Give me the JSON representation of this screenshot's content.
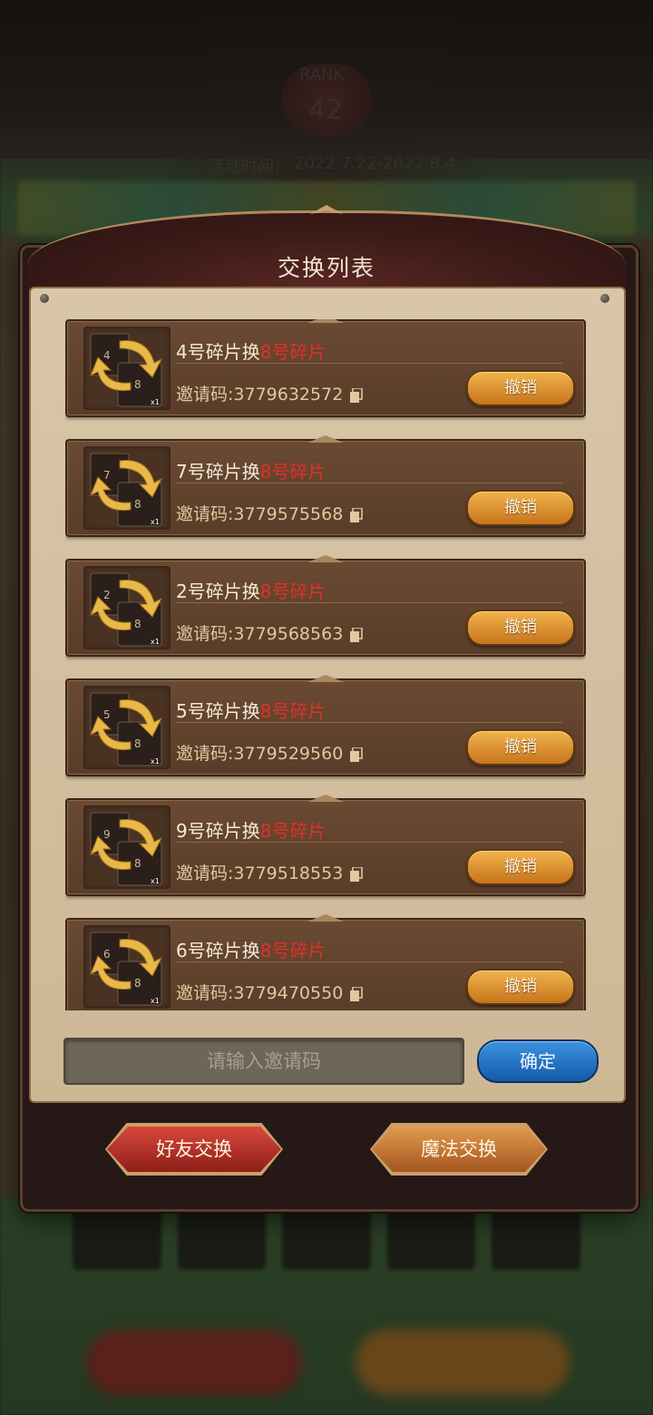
{
  "background": {
    "activity_time_label": "活动时间：",
    "activity_time_value": "2022.7.22-2022.8.4",
    "rank_label": "RANK",
    "rank_value": "42"
  },
  "modal": {
    "title": "交换列表",
    "cards": [
      {
        "from": "4号碎片换",
        "to": "8号碎片",
        "code_label": "邀请码:",
        "code": "3779632572",
        "revoke": "撤销",
        "icon_from": "4",
        "icon_to": "8",
        "icon_qty": "x1"
      },
      {
        "from": "7号碎片换",
        "to": "8号碎片",
        "code_label": "邀请码:",
        "code": "3779575568",
        "revoke": "撤销",
        "icon_from": "7",
        "icon_to": "8",
        "icon_qty": "x1"
      },
      {
        "from": "2号碎片换",
        "to": "8号碎片",
        "code_label": "邀请码:",
        "code": "3779568563",
        "revoke": "撤销",
        "icon_from": "2",
        "icon_to": "8",
        "icon_qty": "x1"
      },
      {
        "from": "5号碎片换",
        "to": "8号碎片",
        "code_label": "邀请码:",
        "code": "3779529560",
        "revoke": "撤销",
        "icon_from": "5",
        "icon_to": "8",
        "icon_qty": "x1"
      },
      {
        "from": "9号碎片换",
        "to": "8号碎片",
        "code_label": "邀请码:",
        "code": "3779518553",
        "revoke": "撤销",
        "icon_from": "9",
        "icon_to": "8",
        "icon_qty": "x1"
      },
      {
        "from": "6号碎片换",
        "to": "8号碎片",
        "code_label": "邀请码:",
        "code": "3779470550",
        "revoke": "撤销",
        "icon_from": "6",
        "icon_to": "8",
        "icon_qty": "x1"
      }
    ],
    "input_placeholder": "请输入邀请码",
    "confirm_label": "确定",
    "friend_exchange_label": "好友交换",
    "magic_exchange_label": "魔法交换"
  },
  "colors": {
    "target_red": "#e0302a",
    "revoke_orange": "#e39a3a",
    "confirm_blue": "#2a7bd0"
  }
}
